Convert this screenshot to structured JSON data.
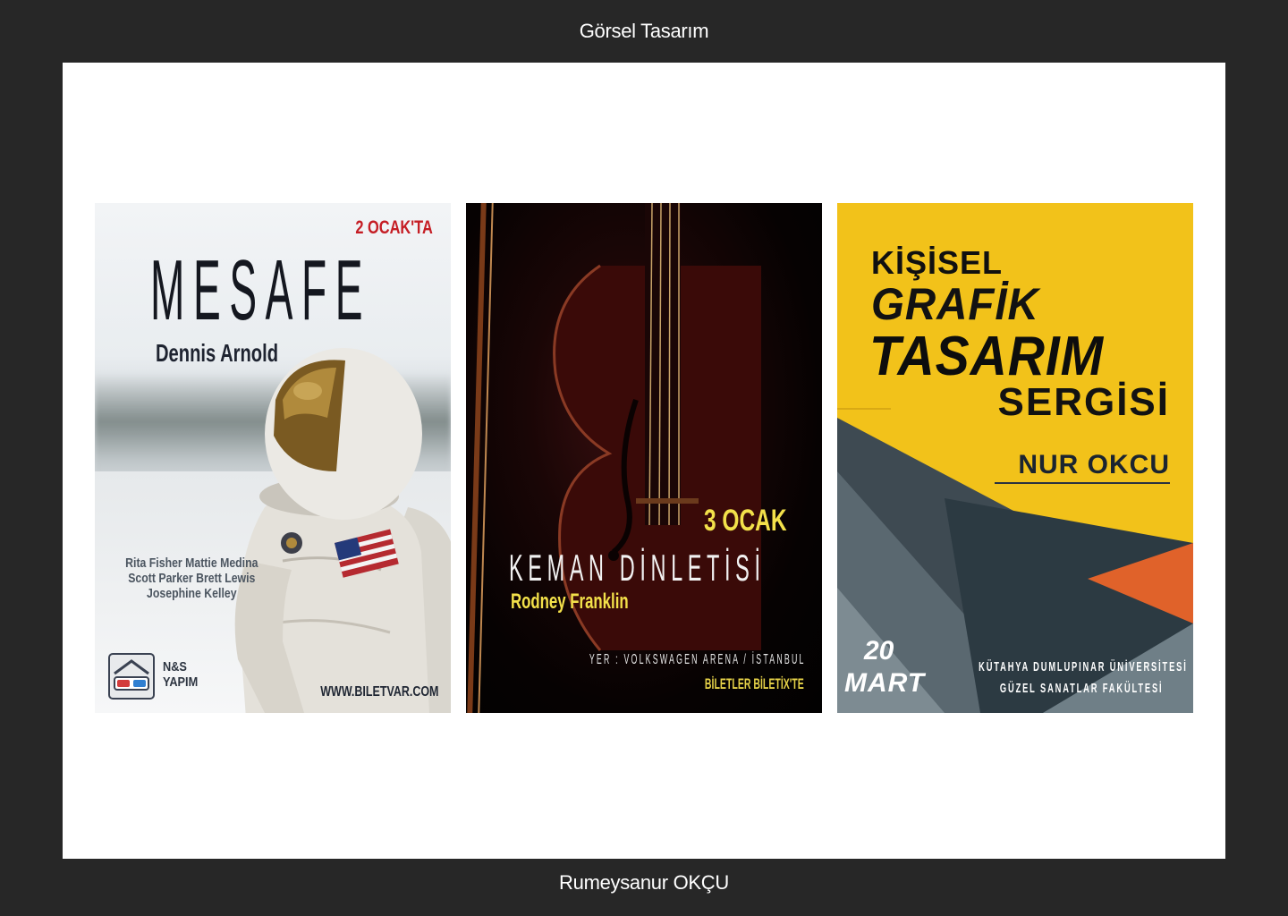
{
  "header": {
    "title": "Görsel Tasarım"
  },
  "footer": {
    "author": "Rumeysanur OKÇU"
  },
  "posters": [
    {
      "date": "2 OCAK'TA",
      "title": "MESAFE",
      "director": "Dennis Arnold",
      "cast": [
        "Rita Fisher Mattie Medina",
        "Scott Parker Brett Lewis",
        "Josephine Kelley"
      ],
      "producer_line1": "N&S",
      "producer_line2": "YAPIM",
      "url": "WWW.BILETVAR.COM"
    },
    {
      "date": "3 OCAK",
      "title": "KEMAN DİNLETİSİ",
      "artist": "Rodney Franklin",
      "venue": "YER : VOLKSWAGEN ARENA / İSTANBUL",
      "tickets": "BİLETLER BİLETİX'TE"
    },
    {
      "line1": "KİŞİSEL",
      "line2": "GRAFİK",
      "line3": "TASARIM",
      "line4": "SERGİSİ",
      "author": "NUR OKCU",
      "day": "20",
      "month": "MART",
      "university": "KÜTAHYA DUMLUPINAR ÜNİVERSİTESİ",
      "faculty": "GÜZEL SANATLAR FAKÜLTESİ"
    }
  ],
  "colors": {
    "page_background": "#272727",
    "canvas": "#ffffff",
    "mesafe_red": "#c51d24",
    "keman_yellow": "#f3e14a",
    "sergi_yellow": "#f2c21a"
  }
}
